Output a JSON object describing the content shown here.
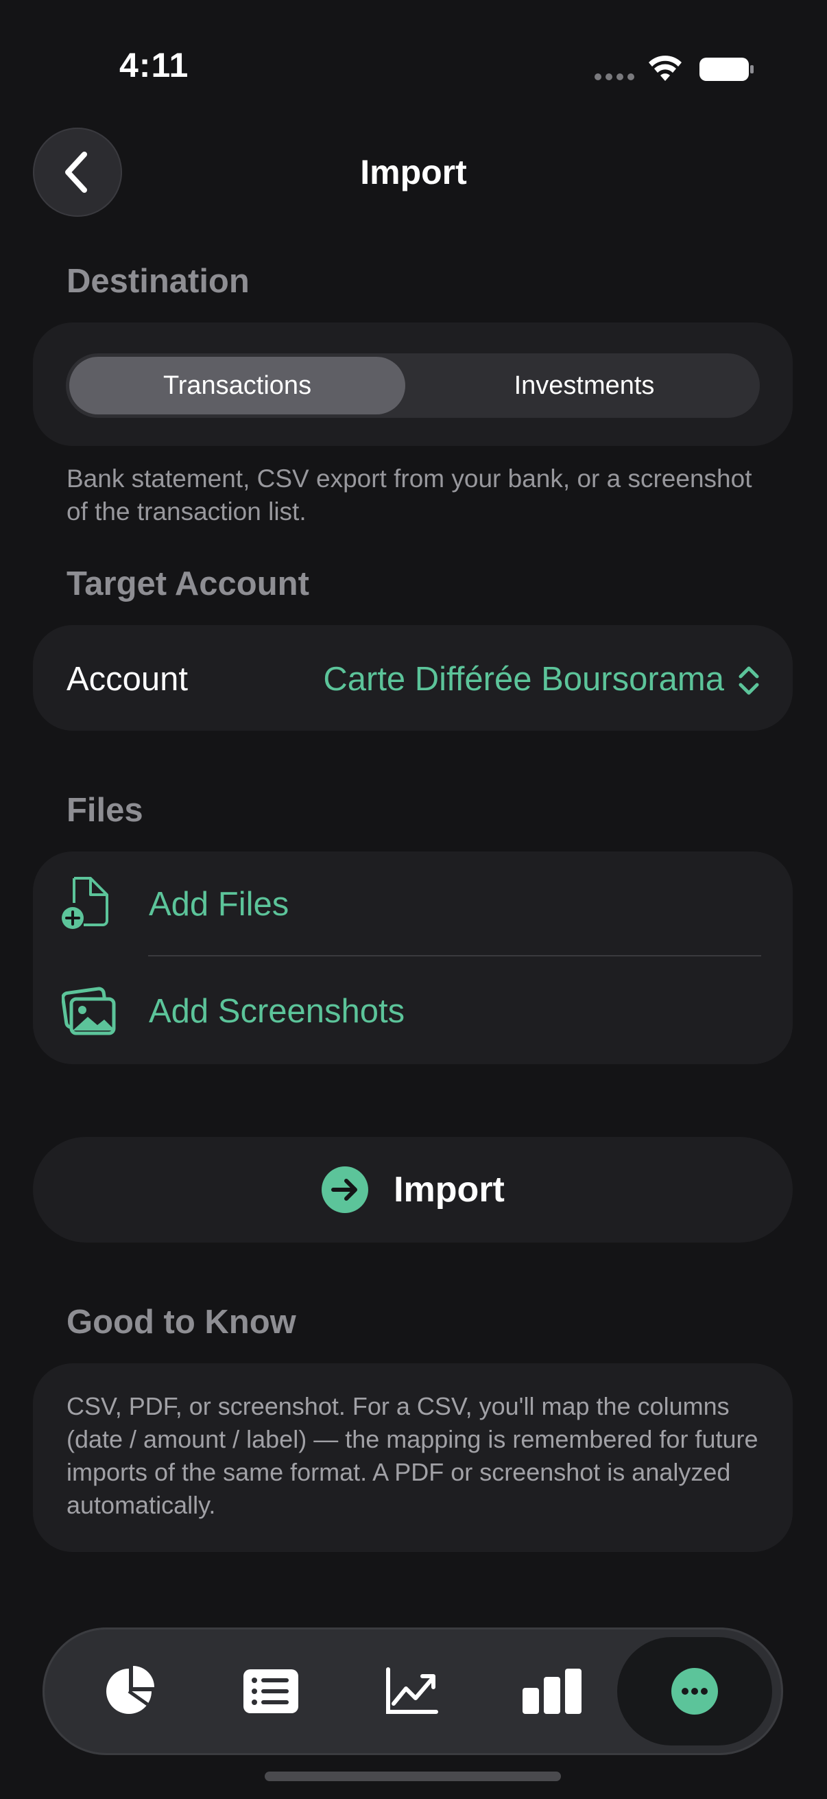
{
  "status_bar": {
    "time": "4:11"
  },
  "nav": {
    "title": "Import",
    "back_icon": "chevron-left-icon"
  },
  "destination": {
    "label": "Destination",
    "options": [
      "Transactions",
      "Investments"
    ],
    "selected": "Transactions",
    "caption": "Bank statement, CSV export from your bank, or a screenshot of the transaction list."
  },
  "target_account": {
    "label": "Target Account",
    "field_label": "Account",
    "value": "Carte Différée Boursorama"
  },
  "files": {
    "label": "Files",
    "add_files": "Add Files",
    "add_screenshots": "Add Screenshots"
  },
  "import_button": {
    "label": "Import"
  },
  "good_to_know": {
    "label": "Good to Know",
    "text": "CSV, PDF, or screenshot. For a CSV, you'll map the columns (date / amount / label) — the mapping is remembered for future imports of the same format. A PDF or screenshot is analyzed automatically."
  },
  "tab_bar": {
    "tabs": [
      "pie-chart-icon",
      "list-icon",
      "trend-chart-icon",
      "bar-chart-icon",
      "more-icon"
    ],
    "active": "more-icon"
  },
  "colors": {
    "accent": "#5cc49a",
    "background": "#141416",
    "card": "#1e1e21"
  }
}
